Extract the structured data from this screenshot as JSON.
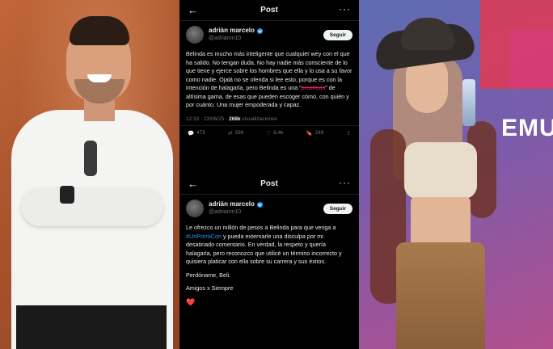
{
  "tweet1": {
    "header_title": "Post",
    "author_name": "adrián marcelo",
    "author_handle": "@adrianm10",
    "follow_label": "Seguir",
    "text_before": "Belinda es mucho más inteligente que cualquier wey con el que ha salido. No tengan duda. No hay nadie más consciente de lo que tiene y ejerce sobre los hombres que ella y lo usa a su favor como nadie. Ojalá no se ofenda si lee esto, porque es con la intención de halagarla, pero Belinda es una “",
    "struck_word": "prostituta",
    "text_after": "” de altísima gama, de esas que pueden escoger cómo, con quién y por cuánto. Una mujer empoderada y capaz.",
    "timestamp": "12:33 · 22/06/25 ·",
    "views_count": "268k",
    "views_label": "visualizaciones",
    "replies": "475",
    "reposts": "336",
    "likes": "6.4k",
    "bookmarks": "249"
  },
  "tweet2": {
    "header_title": "Post",
    "author_name": "adrián marcelo",
    "author_handle": "@adrianm10",
    "follow_label": "Seguir",
    "para1_before": "Le ofrezco un millón de pesos a Belinda para que venga a ",
    "hashtag": "#UnPorroCon",
    "para1_after": " y pueda externarle una disculpa por mi desatinado comentario. En verdad, la respeto y quería halagarla, pero reconozco que utilicé un término incorrecto y quisiera platicar con ella sobre su carrera y sus éxitos.",
    "para2": "Perdóname, Beli.",
    "para3": "Amigos x Siempre",
    "heart": "❤️"
  },
  "brand_text": "EMUI"
}
